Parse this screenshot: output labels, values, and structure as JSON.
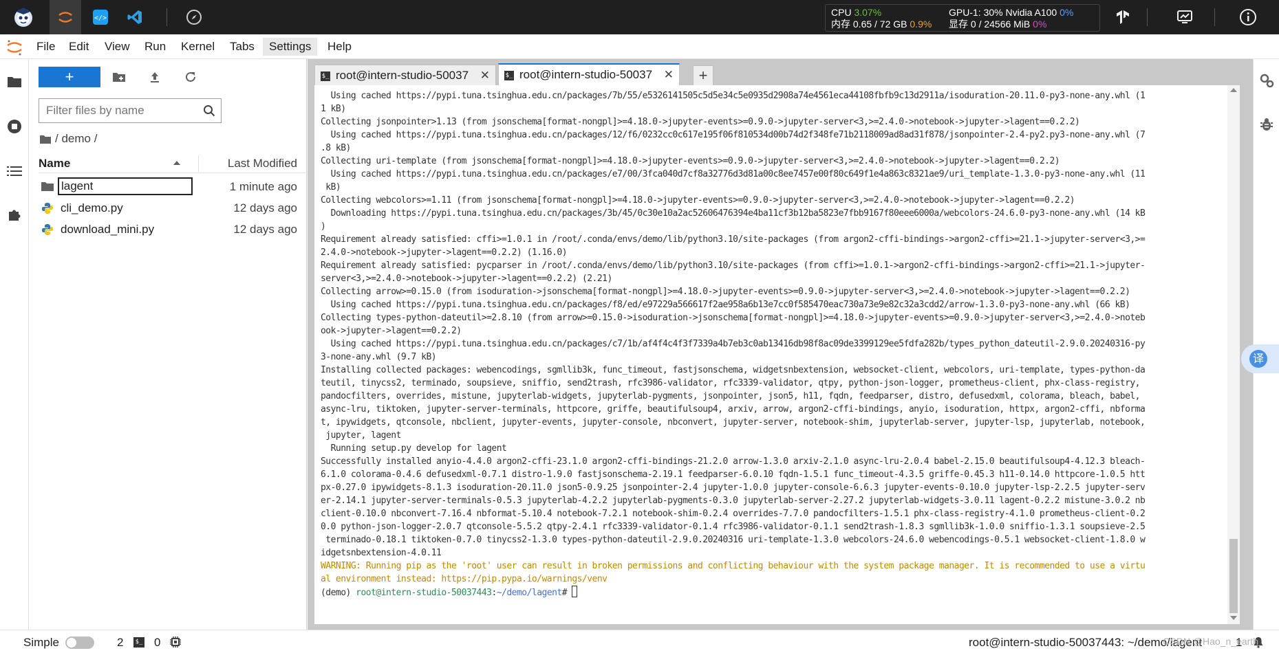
{
  "topbar": {
    "resources": {
      "cpu_label": "CPU",
      "cpu_value": "3.07%",
      "mem_label": "内存 0.65 / 72 GB",
      "mem_value": "0.9%",
      "gpu_label": "GPU-1: 30% Nvidia A100",
      "gpu_value": "0%",
      "vram_label": "显存 0 / 24566 MiB",
      "vram_value": "0%"
    }
  },
  "menu": {
    "items": [
      "File",
      "Edit",
      "View",
      "Run",
      "Kernel",
      "Tabs",
      "Settings",
      "Help"
    ]
  },
  "filebrowser": {
    "new_label": "+",
    "filter_placeholder": "Filter files by name",
    "breadcrumb": "/ demo /",
    "col_name": "Name",
    "col_modified": "Last Modified",
    "files": [
      {
        "name": "lagent",
        "modified": "1 minute ago",
        "type": "folder"
      },
      {
        "name": "cli_demo.py",
        "modified": "12 days ago",
        "type": "python"
      },
      {
        "name": "download_mini.py",
        "modified": "12 days ago",
        "type": "python"
      }
    ]
  },
  "tabs": [
    {
      "label": "root@intern-studio-50037",
      "close": "✕"
    },
    {
      "label": "root@intern-studio-50037",
      "close": "✕"
    }
  ],
  "add_tab_label": "+",
  "terminal": {
    "lines": [
      "  Using cached https://pypi.tuna.tsinghua.edu.cn/packages/7b/55/e5326141505c5d5e34c5e0935d2908a74e4561eca44108fbfb9c13d2911a/isoduration-20.11.0-py3-none-any.whl (1",
      "1 kB)",
      "Collecting jsonpointer>1.13 (from jsonschema[format-nongpl]>=4.18.0->jupyter-events>=0.9.0->jupyter-server<3,>=2.4.0->notebook->jupyter->lagent==0.2.2)",
      "  Using cached https://pypi.tuna.tsinghua.edu.cn/packages/12/f6/0232cc0c617e195f06f810534d00b74d2f348fe71b2118009ad8ad31f878/jsonpointer-2.4-py2.py3-none-any.whl (7",
      ".8 kB)",
      "Collecting uri-template (from jsonschema[format-nongpl]>=4.18.0->jupyter-events>=0.9.0->jupyter-server<3,>=2.4.0->notebook->jupyter->lagent==0.2.2)",
      "  Using cached https://pypi.tuna.tsinghua.edu.cn/packages/e7/00/3fca040d7cf8a32776d3d81a00c8ee7457e00f80c649f1e4a863c8321ae9/uri_template-1.3.0-py3-none-any.whl (11",
      " kB)",
      "Collecting webcolors>=1.11 (from jsonschema[format-nongpl]>=4.18.0->jupyter-events>=0.9.0->jupyter-server<3,>=2.4.0->notebook->jupyter->lagent==0.2.2)",
      "  Downloading https://pypi.tuna.tsinghua.edu.cn/packages/3b/45/0c30e10a2ac52606476394e4ba11cf3b12ba5823e7fbb9167f80eee6000a/webcolors-24.6.0-py3-none-any.whl (14 kB",
      ")",
      "Requirement already satisfied: cffi>=1.0.1 in /root/.conda/envs/demo/lib/python3.10/site-packages (from argon2-cffi-bindings->argon2-cffi>=21.1->jupyter-server<3,>=",
      "2.4.0->notebook->jupyter->lagent==0.2.2) (1.16.0)",
      "Requirement already satisfied: pycparser in /root/.conda/envs/demo/lib/python3.10/site-packages (from cffi>=1.0.1->argon2-cffi-bindings->argon2-cffi>=21.1->jupyter-",
      "server<3,>=2.4.0->notebook->jupyter->lagent==0.2.2) (2.21)",
      "Collecting arrow>=0.15.0 (from isoduration->jsonschema[format-nongpl]>=4.18.0->jupyter-events>=0.9.0->jupyter-server<3,>=2.4.0->notebook->jupyter->lagent==0.2.2)",
      "  Using cached https://pypi.tuna.tsinghua.edu.cn/packages/f8/ed/e97229a566617f2ae958a6b13e7cc0f585470eac730a73e9e82c32a3cdd2/arrow-1.3.0-py3-none-any.whl (66 kB)",
      "Collecting types-python-dateutil>=2.8.10 (from arrow>=0.15.0->isoduration->jsonschema[format-nongpl]>=4.18.0->jupyter-events>=0.9.0->jupyter-server<3,>=2.4.0->noteb",
      "ook->jupyter->lagent==0.2.2)",
      "  Using cached https://pypi.tuna.tsinghua.edu.cn/packages/c7/1b/af4f4c4f3f7339a4b7eb3c0ab13416db98f8ac09de3399129ee5fdfa282b/types_python_dateutil-2.9.0.20240316-py",
      "3-none-any.whl (9.7 kB)",
      "Installing collected packages: webencodings, sgmllib3k, func_timeout, fastjsonschema, widgetsnbextension, websocket-client, webcolors, uri-template, types-python-da",
      "teutil, tinycss2, terminado, soupsieve, sniffio, send2trash, rfc3986-validator, rfc3339-validator, qtpy, python-json-logger, prometheus-client, phx-class-registry,",
      "pandocfilters, overrides, mistune, jupyterlab-widgets, jupyterlab-pygments, jsonpointer, json5, h11, fqdn, feedparser, distro, defusedxml, colorama, bleach, babel,",
      "async-lru, tiktoken, jupyter-server-terminals, httpcore, griffe, beautifulsoup4, arxiv, arrow, argon2-cffi-bindings, anyio, isoduration, httpx, argon2-cffi, nbforma",
      "t, ipywidgets, qtconsole, nbclient, jupyter-events, jupyter-console, nbconvert, jupyter-server, notebook-shim, jupyterlab-server, jupyter-lsp, jupyterlab, notebook,",
      " jupyter, lagent",
      "  Running setup.py develop for lagent",
      "Successfully installed anyio-4.4.0 argon2-cffi-23.1.0 argon2-cffi-bindings-21.2.0 arrow-1.3.0 arxiv-2.1.0 async-lru-2.0.4 babel-2.15.0 beautifulsoup4-4.12.3 bleach-",
      "6.1.0 colorama-0.4.6 defusedxml-0.7.1 distro-1.9.0 fastjsonschema-2.19.1 feedparser-6.0.10 fqdn-1.5.1 func_timeout-4.3.5 griffe-0.45.3 h11-0.14.0 httpcore-1.0.5 htt",
      "px-0.27.0 ipywidgets-8.1.3 isoduration-20.11.0 json5-0.9.25 jsonpointer-2.4 jupyter-1.0.0 jupyter-console-6.6.3 jupyter-events-0.10.0 jupyter-lsp-2.2.5 jupyter-serv",
      "er-2.14.1 jupyter-server-terminals-0.5.3 jupyterlab-4.2.2 jupyterlab-pygments-0.3.0 jupyterlab-server-2.27.2 jupyterlab-widgets-3.0.11 lagent-0.2.2 mistune-3.0.2 nb",
      "client-0.10.0 nbconvert-7.16.4 nbformat-5.10.4 notebook-7.2.1 notebook-shim-0.2.4 overrides-7.7.0 pandocfilters-1.5.1 phx-class-registry-4.1.0 prometheus-client-0.2",
      "0.0 python-json-logger-2.0.7 qtconsole-5.5.2 qtpy-2.4.1 rfc3339-validator-0.1.4 rfc3986-validator-0.1.1 send2trash-1.8.3 sgmllib3k-1.0.0 sniffio-1.3.1 soupsieve-2.5",
      " terminado-0.18.1 tiktoken-0.7.0 tinycss2-1.3.0 types-python-dateutil-2.9.0.20240316 uri-template-1.3.0 webcolors-24.6.0 webencodings-0.5.1 websocket-client-1.8.0 w",
      "idgetsnbextension-4.0.11"
    ],
    "warning_lines": [
      "WARNING: Running pip as the 'root' user can result in broken permissions and conflicting behaviour with the system package manager. It is recommended to use a virtu",
      "al environment instead: https://pip.pypa.io/warnings/venv"
    ],
    "prompt": {
      "env": "(demo) ",
      "user": "root@intern-studio-50037443",
      "sep": ":",
      "path": "~/demo/lagent",
      "symbol": "# "
    }
  },
  "statusbar": {
    "mode_label": "Simple",
    "kernels_count": "2",
    "terminals_count": "0",
    "right_text": "root@intern-studio-50037443: ~/demo/lagent",
    "right_num": "1",
    "watermark": "CSDN @Hao_n_earth"
  },
  "translate_label": "译",
  "colors": {
    "accent": "#1976d2",
    "topbar_bg": "#1f1f1f",
    "cpu_green": "#66c23a",
    "mem_orange": "#e6a23c",
    "warning": "#c08a00"
  }
}
